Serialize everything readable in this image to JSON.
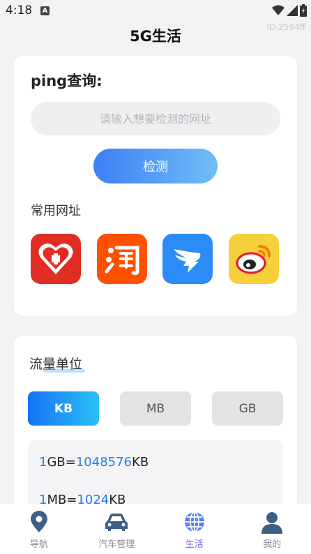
{
  "status_bar": {
    "time": "4:18",
    "notification_badge": "A"
  },
  "header": {
    "title": "5G生活",
    "id_tag": "ID:2594ff"
  },
  "ping": {
    "title": "ping查询:",
    "input_placeholder": "请输入想要检测的网址",
    "input_value": "",
    "detect_label": "检测",
    "common_title": "常用网址",
    "sites": [
      {
        "name": "pinduoduo-icon"
      },
      {
        "name": "taobao-icon"
      },
      {
        "name": "dingtalk-icon"
      },
      {
        "name": "weibo-icon"
      }
    ]
  },
  "unit": {
    "title": "流量单位",
    "buttons": [
      {
        "label": "KB",
        "active": true
      },
      {
        "label": "MB",
        "active": false
      },
      {
        "label": "GB",
        "active": false
      }
    ],
    "conversions": [
      {
        "left_num": "1",
        "left_unit": "GB=",
        "right_num": "1048576",
        "right_unit": "KB"
      },
      {
        "left_num": "1",
        "left_unit": "MB=",
        "right_num": "1024",
        "right_unit": "KB"
      }
    ]
  },
  "tabs": [
    {
      "label": "导航",
      "icon": "location-pin-icon",
      "active": false
    },
    {
      "label": "汽车管理",
      "icon": "car-icon",
      "active": false
    },
    {
      "label": "生活",
      "icon": "globe-icon",
      "active": true
    },
    {
      "label": "我的",
      "icon": "user-icon",
      "active": false
    }
  ],
  "colors": {
    "accent_blue": "#1f7ef5",
    "tab_active": "#7b62e8"
  }
}
